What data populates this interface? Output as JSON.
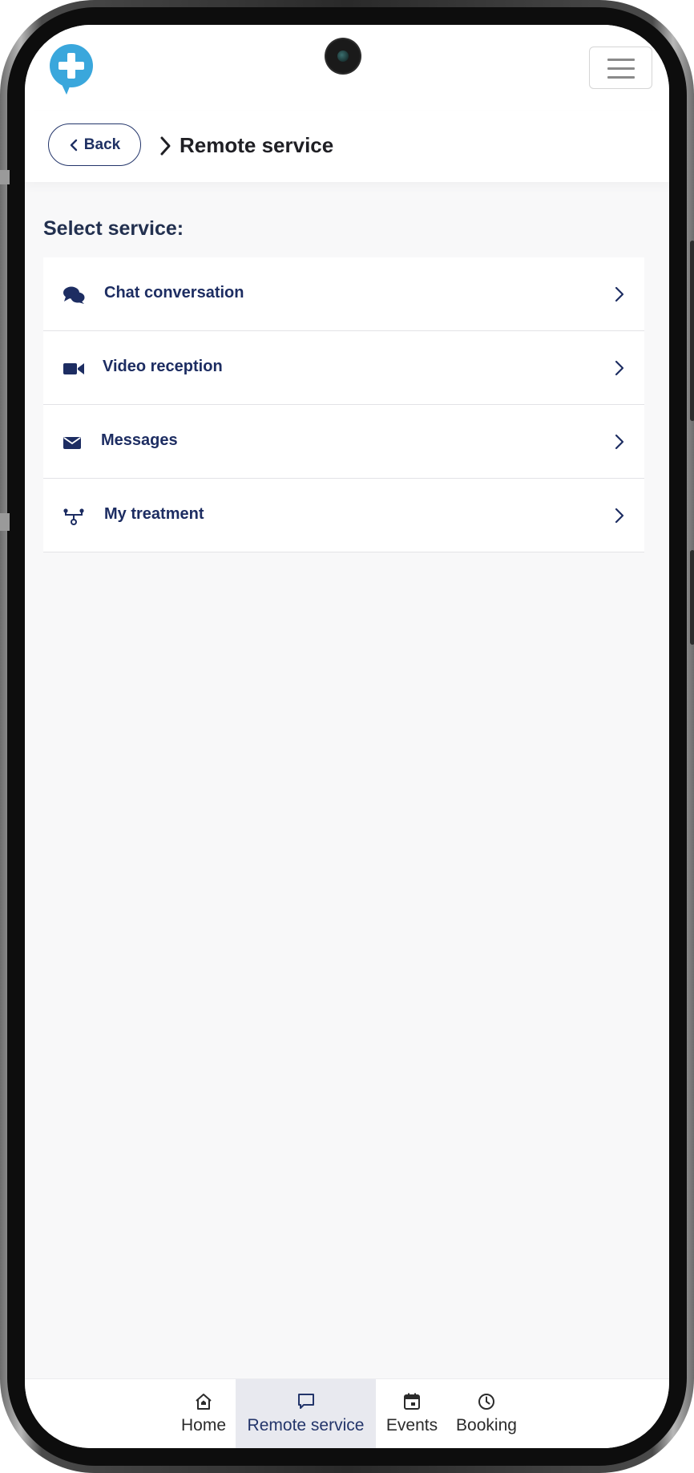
{
  "header": {
    "logo_icon": "medical-cross-chat-logo",
    "menu_icon": "hamburger-menu-icon"
  },
  "breadcrumb": {
    "back_label": "Back",
    "current": "Remote service"
  },
  "content": {
    "section_label": "Select service:",
    "services": [
      {
        "label": "Chat conversation",
        "icon": "chat-bubbles-icon"
      },
      {
        "label": "Video reception",
        "icon": "video-camera-icon"
      },
      {
        "label": "Messages",
        "icon": "envelope-icon"
      },
      {
        "label": "My treatment",
        "icon": "treatment-nodes-icon"
      }
    ]
  },
  "bottom_nav": {
    "items": [
      {
        "label": "Home",
        "icon": "home-icon",
        "active": false
      },
      {
        "label": "Remote service",
        "icon": "chat-icon",
        "active": true
      },
      {
        "label": "Events",
        "icon": "calendar-icon",
        "active": false
      },
      {
        "label": "Booking",
        "icon": "clock-icon",
        "active": false
      }
    ]
  },
  "colors": {
    "accent": "#23356a",
    "logo": "#3aa7dc",
    "background": "#f8f8f9",
    "active_tab": "#e8e9ef"
  }
}
